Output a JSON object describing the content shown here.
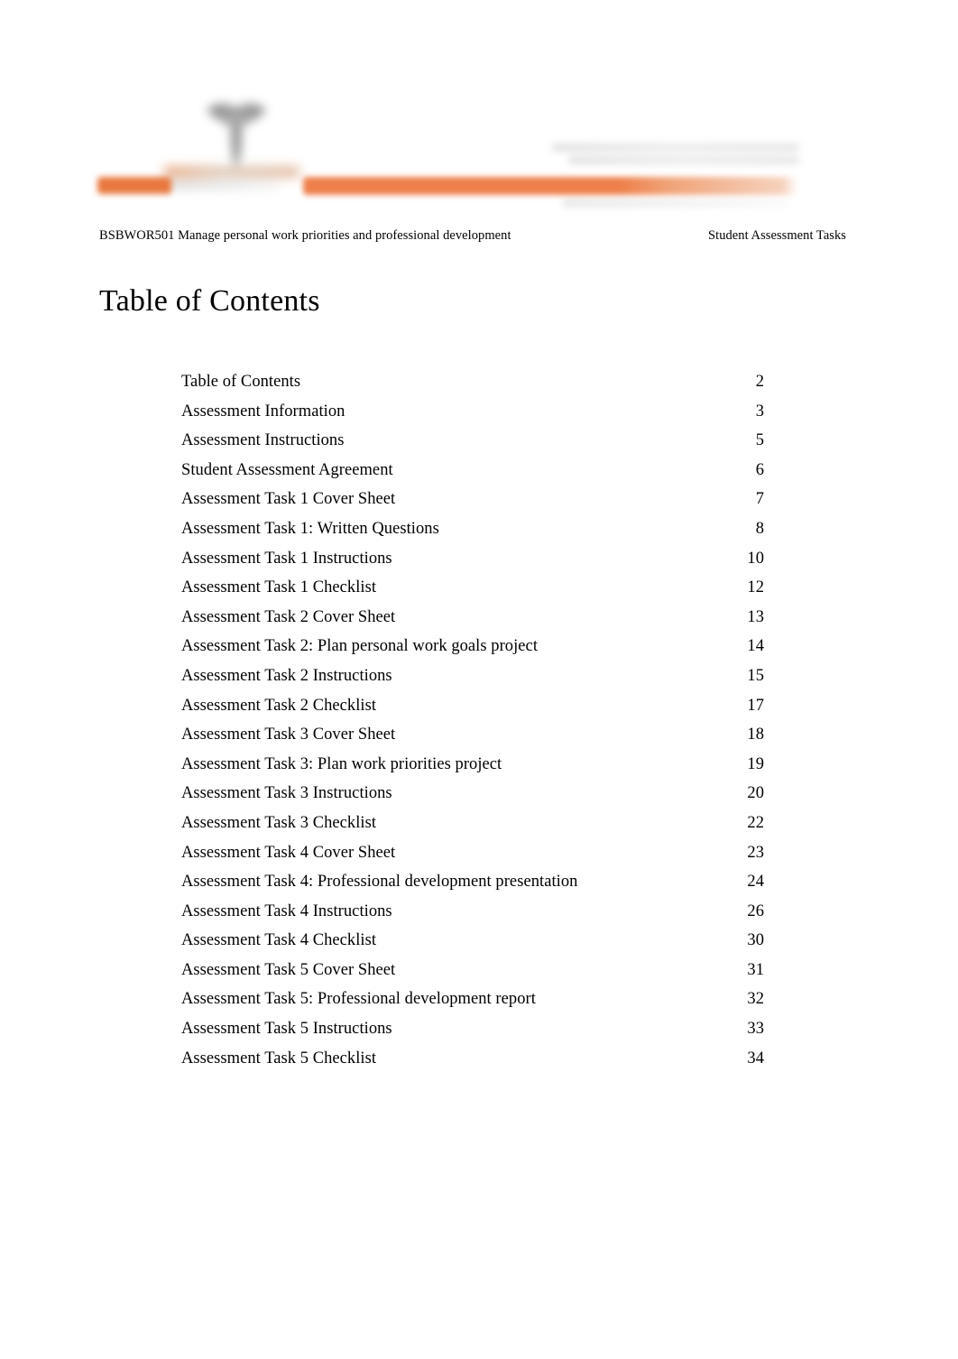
{
  "header": {
    "left_text": "BSBWOR501 Manage personal work priorities and professional development",
    "right_text": "Student Assessment Tasks"
  },
  "letterhead": {
    "logo_icon": "organisation-logo-mark",
    "wordmark": "blurred-organisation-wordmark",
    "tagline": "blurred-tagline-text",
    "accent_color": "#ee7f4a",
    "accent_color_secondary": "#e8783e"
  },
  "title": "Table of Contents",
  "toc": {
    "entries": [
      {
        "label": "Table of Contents",
        "page": "2"
      },
      {
        "label": "Assessment Information",
        "page": "3"
      },
      {
        "label": "Assessment Instructions",
        "page": "5"
      },
      {
        "label": "Student Assessment Agreement",
        "page": "6"
      },
      {
        "label": "Assessment Task 1 Cover Sheet",
        "page": "7"
      },
      {
        "label": "Assessment Task 1: Written Questions",
        "page": "8"
      },
      {
        "label": "Assessment Task 1 Instructions",
        "page": "10"
      },
      {
        "label": "Assessment Task 1 Checklist",
        "page": "12"
      },
      {
        "label": "Assessment Task 2 Cover Sheet",
        "page": "13"
      },
      {
        "label": "Assessment Task 2: Plan personal work goals project",
        "page": "14"
      },
      {
        "label": "Assessment Task 2 Instructions",
        "page": "15"
      },
      {
        "label": "Assessment Task 2 Checklist",
        "page": "17"
      },
      {
        "label": "Assessment Task 3 Cover Sheet",
        "page": "18"
      },
      {
        "label": "Assessment Task 3: Plan work priorities project",
        "page": "19"
      },
      {
        "label": "Assessment Task 3 Instructions",
        "page": "20"
      },
      {
        "label": "Assessment Task 3 Checklist",
        "page": "22"
      },
      {
        "label": "Assessment Task 4 Cover Sheet",
        "page": "23"
      },
      {
        "label": "Assessment Task 4: Professional development presentation",
        "page": "24"
      },
      {
        "label": "Assessment Task 4 Instructions",
        "page": "26"
      },
      {
        "label": "Assessment Task 4 Checklist",
        "page": "30"
      },
      {
        "label": "Assessment Task 5 Cover Sheet",
        "page": "31"
      },
      {
        "label": "Assessment Task 5: Professional development report",
        "page": "32"
      },
      {
        "label": "Assessment Task 5 Instructions",
        "page": "33"
      },
      {
        "label": "Assessment Task 5 Checklist",
        "page": "34"
      }
    ]
  }
}
